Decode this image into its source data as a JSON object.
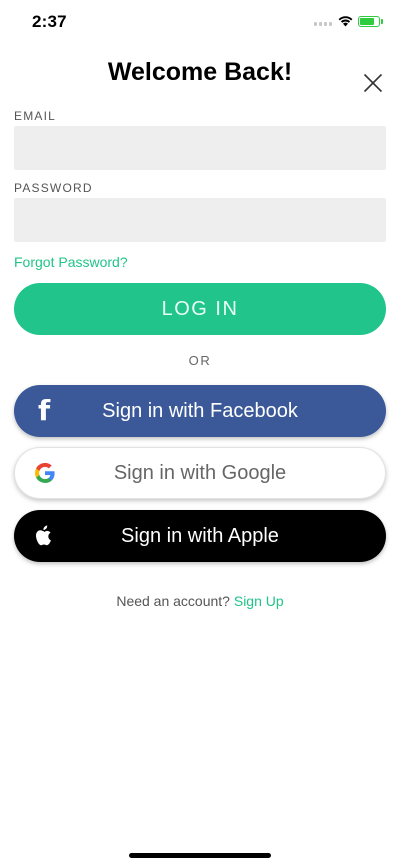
{
  "status_bar": {
    "time": "2:37"
  },
  "header": {
    "title": "Welcome Back!"
  },
  "form": {
    "email_label": "EMAIL",
    "email_value": "",
    "password_label": "PASSWORD",
    "password_value": "",
    "forgot_password": "Forgot Password?"
  },
  "actions": {
    "login_label": "LOG IN",
    "or_label": "OR",
    "facebook_label": "Sign in with Facebook",
    "google_label": "Sign in with Google",
    "apple_label": "Sign in with Apple"
  },
  "footer": {
    "prompt": "Need an account?",
    "signup_label": "Sign Up"
  },
  "colors": {
    "accent": "#21c48a",
    "facebook": "#3b5998",
    "apple": "#000000",
    "field_bg": "#eeeeee"
  },
  "icons": [
    "signal-icon",
    "wifi-icon",
    "battery-icon",
    "close-icon",
    "facebook-icon",
    "google-icon",
    "apple-icon"
  ]
}
